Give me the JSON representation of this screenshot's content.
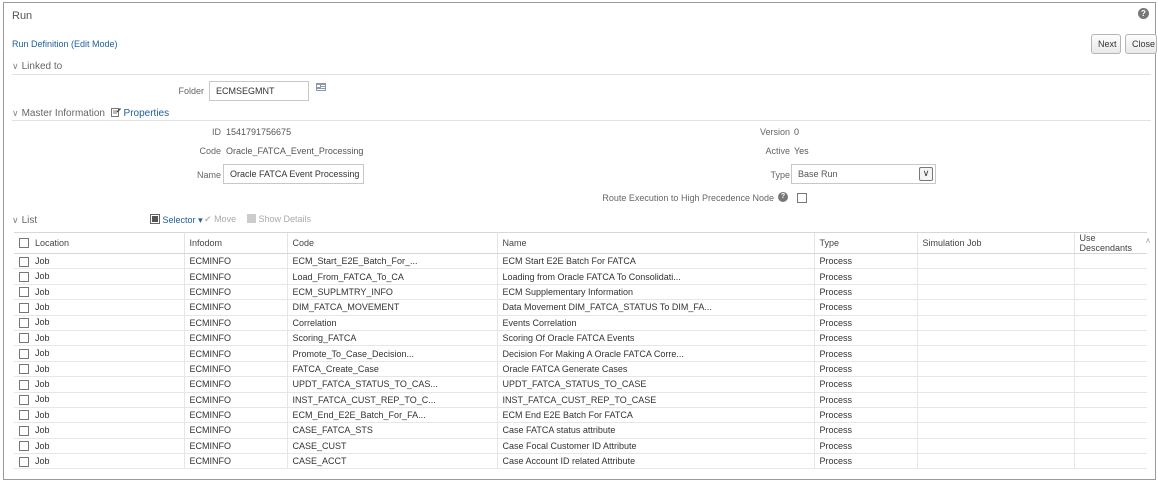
{
  "window": {
    "title": "Run",
    "help_icon": "help-icon"
  },
  "header": {
    "subtitle": "Run Definition (Edit Mode)",
    "next_label": "Next",
    "close_label": "Close"
  },
  "linked_to": {
    "heading": "Linked to",
    "folder_label": "Folder",
    "folder_value": "ECMSEGMNT",
    "folder_picker_icon": "folder-picker-icon"
  },
  "master_info": {
    "heading": "Master Information",
    "properties_link": "Properties",
    "id_label": "ID",
    "id_value": "1541791756675",
    "code_label": "Code",
    "code_value": "Oracle_FATCA_Event_Processing",
    "name_label": "Name",
    "name_value": "Oracle FATCA Event Processing",
    "version_label": "Version",
    "version_value": "0",
    "active_label": "Active",
    "active_value": "Yes",
    "type_label": "Type",
    "type_value": "Base Run",
    "route_label": "Route Execution to High Precedence Node"
  },
  "list": {
    "heading": "List",
    "selector_label": "Selector",
    "move_label": "Move",
    "show_details_label": "Show Details",
    "columns": [
      "Location",
      "Infodom",
      "Code",
      "Name",
      "Type",
      "Simulation Job",
      "Use Descendants"
    ],
    "rows": [
      {
        "location": "Job",
        "infodom": "ECMINFO",
        "code": "ECM_Start_E2E_Batch_For_...",
        "name": "ECM Start E2E Batch For FATCA",
        "type": "Process"
      },
      {
        "location": "Job",
        "infodom": "ECMINFO",
        "code": "Load_From_FATCA_To_CA",
        "name": "Loading from Oracle FATCA To Consolidati...",
        "type": "Process"
      },
      {
        "location": "Job",
        "infodom": "ECMINFO",
        "code": "ECM_SUPLMTRY_INFO",
        "name": "ECM Supplementary Information",
        "type": "Process"
      },
      {
        "location": "Job",
        "infodom": "ECMINFO",
        "code": "DIM_FATCA_MOVEMENT",
        "name": "Data Movement DIM_FATCA_STATUS To DIM_FA...",
        "type": "Process"
      },
      {
        "location": "Job",
        "infodom": "ECMINFO",
        "code": "Correlation",
        "name": "Events Correlation",
        "type": "Process"
      },
      {
        "location": "Job",
        "infodom": "ECMINFO",
        "code": "Scoring_FATCA",
        "name": "Scoring Of Oracle FATCA Events",
        "type": "Process"
      },
      {
        "location": "Job",
        "infodom": "ECMINFO",
        "code": "Promote_To_Case_Decision...",
        "name": "Decision For Making A Oracle FATCA Corre...",
        "type": "Process"
      },
      {
        "location": "Job",
        "infodom": "ECMINFO",
        "code": "FATCA_Create_Case",
        "name": "Oracle FATCA Generate Cases",
        "type": "Process"
      },
      {
        "location": "Job",
        "infodom": "ECMINFO",
        "code": "UPDT_FATCA_STATUS_TO_CAS...",
        "name": "UPDT_FATCA_STATUS_TO_CASE",
        "type": "Process"
      },
      {
        "location": "Job",
        "infodom": "ECMINFO",
        "code": "INST_FATCA_CUST_REP_TO_C...",
        "name": "INST_FATCA_CUST_REP_TO_CASE",
        "type": "Process"
      },
      {
        "location": "Job",
        "infodom": "ECMINFO",
        "code": "ECM_End_E2E_Batch_For_FA...",
        "name": "ECM End E2E Batch For FATCA",
        "type": "Process"
      },
      {
        "location": "Job",
        "infodom": "ECMINFO",
        "code": "CASE_FATCA_STS",
        "name": "Case FATCA status attribute",
        "type": "Process"
      },
      {
        "location": "Job",
        "infodom": "ECMINFO",
        "code": "CASE_CUST",
        "name": "Case Focal Customer ID Attribute",
        "type": "Process"
      },
      {
        "location": "Job",
        "infodom": "ECMINFO",
        "code": "CASE_ACCT",
        "name": "Case Account ID related Attribute",
        "type": "Process"
      }
    ]
  },
  "colors": {
    "link": "#1f5d99",
    "border": "#9a9a9a",
    "text": "#333333"
  }
}
